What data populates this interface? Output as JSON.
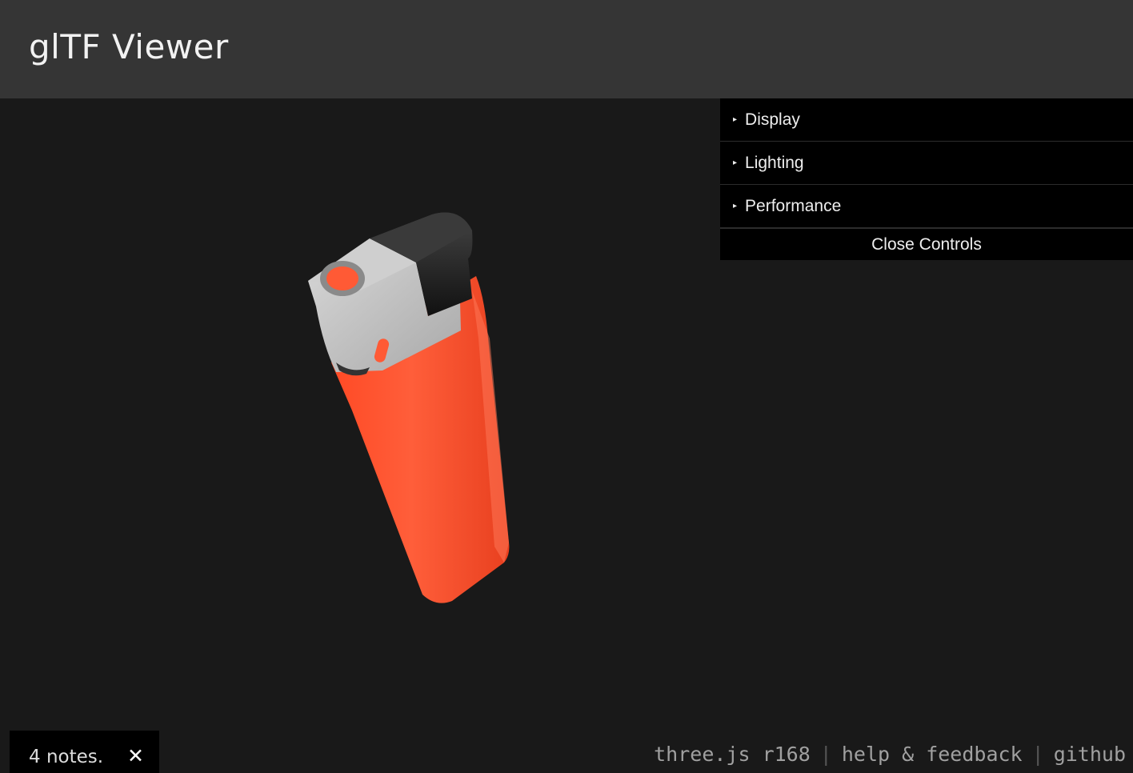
{
  "header": {
    "title": "glTF Viewer"
  },
  "gui": {
    "folders": [
      {
        "label": "Display"
      },
      {
        "label": "Lighting"
      },
      {
        "label": "Performance"
      }
    ],
    "close_label": "Close Controls",
    "expand_glyph": "▸"
  },
  "notes": {
    "text": "4 notes.",
    "close_glyph": "✕"
  },
  "footer": {
    "version": "three.js r168",
    "separator": "|",
    "help": "help & feedback",
    "github": "github"
  },
  "colors": {
    "header_bg": "#353535",
    "viewport_bg": "#191919",
    "lighter_body": "#ff5a35",
    "lighter_metal": "#c8c8c8",
    "lighter_cap": "#2a2a2a"
  },
  "model": {
    "name": "lighter"
  }
}
